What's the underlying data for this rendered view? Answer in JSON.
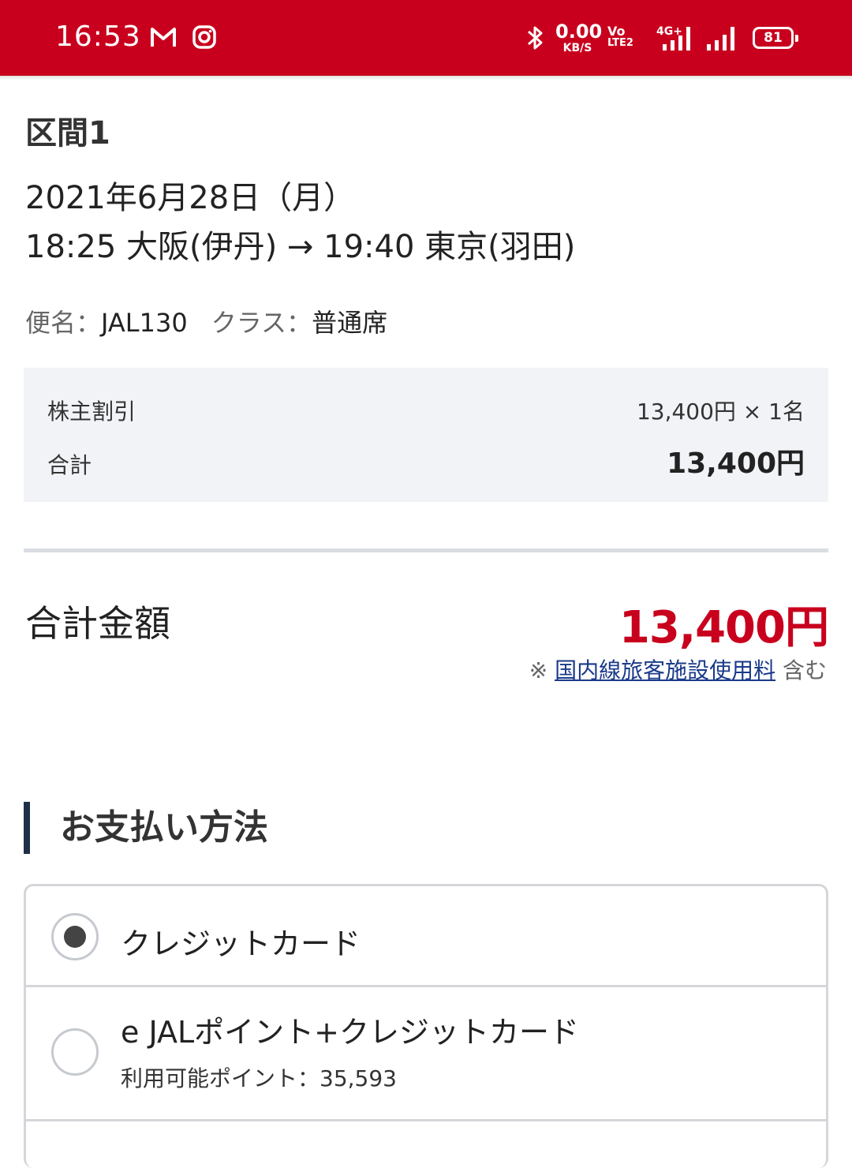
{
  "status_bar": {
    "time": "16:53",
    "net_speed_value": "0.00",
    "net_speed_unit": "KB/S",
    "volte": "Vo",
    "volte2": "LTE2",
    "network": "4G+",
    "battery": "81",
    "icons": [
      "gmail-icon",
      "instagram-icon",
      "bluetooth-icon",
      "signal-icon",
      "battery-icon"
    ],
    "color": "#c8001e"
  },
  "segment": {
    "title": "区間1",
    "date": "2021年6月28日（月）",
    "route": "18:25 大阪(伊丹) → 19:40 東京(羽田)",
    "flight_label": "便名：",
    "flight_no": "JAL130",
    "class_label": "クラス：",
    "class_value": "普通席"
  },
  "fare": {
    "type_label": "株主割引",
    "type_value": "13,400円 × 1名",
    "subtotal_label": "合計",
    "subtotal_value": "13,400円"
  },
  "total": {
    "label": "合計金額",
    "value": "13,400円",
    "note_prefix": "※",
    "note_link": "国内線旅客施設使用料",
    "note_suffix": "含む",
    "accent_color": "#c8001e"
  },
  "payment": {
    "heading": "お支払い方法",
    "options": [
      {
        "label": "クレジットカード",
        "checked": true
      },
      {
        "label": "e JALポイント+クレジットカード",
        "sub": "利用可能ポイント：35,593",
        "checked": false
      }
    ]
  }
}
